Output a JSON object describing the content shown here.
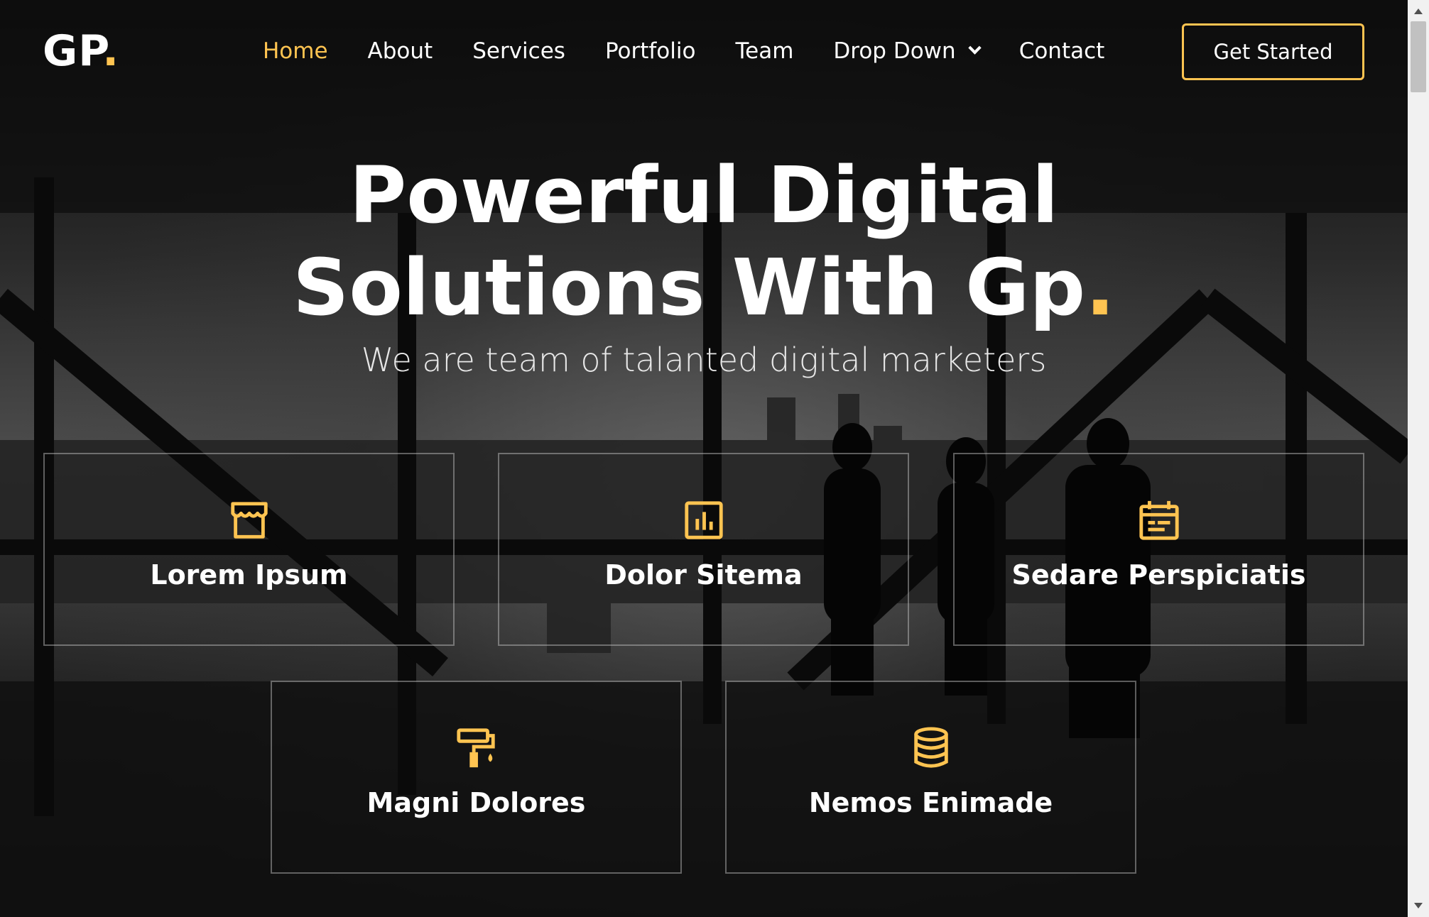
{
  "brand": {
    "name": "GP",
    "dot": "."
  },
  "nav": {
    "items": [
      {
        "label": "Home",
        "active": true
      },
      {
        "label": "About"
      },
      {
        "label": "Services"
      },
      {
        "label": "Portfolio"
      },
      {
        "label": "Team"
      },
      {
        "label": "Drop Down",
        "has_dropdown": true
      },
      {
        "label": "Contact"
      }
    ],
    "cta_label": "Get Started"
  },
  "hero": {
    "title_line1": "Powerful Digital",
    "title_line2": "Solutions With Gp",
    "title_dot": ".",
    "subtitle": "We are team of talanted digital marketers"
  },
  "features": [
    {
      "label": "Lorem Ipsum",
      "icon": "store-icon"
    },
    {
      "label": "Dolor Sitema",
      "icon": "bar-chart-icon"
    },
    {
      "label": "Sedare Perspiciatis",
      "icon": "calendar-icon"
    },
    {
      "label": "Magni Dolores",
      "icon": "paint-roller-icon"
    },
    {
      "label": "Nemos Enimade",
      "icon": "database-icon"
    }
  ],
  "colors": {
    "accent": "#ffc451",
    "text": "#ffffff",
    "overlay": "#000000"
  }
}
